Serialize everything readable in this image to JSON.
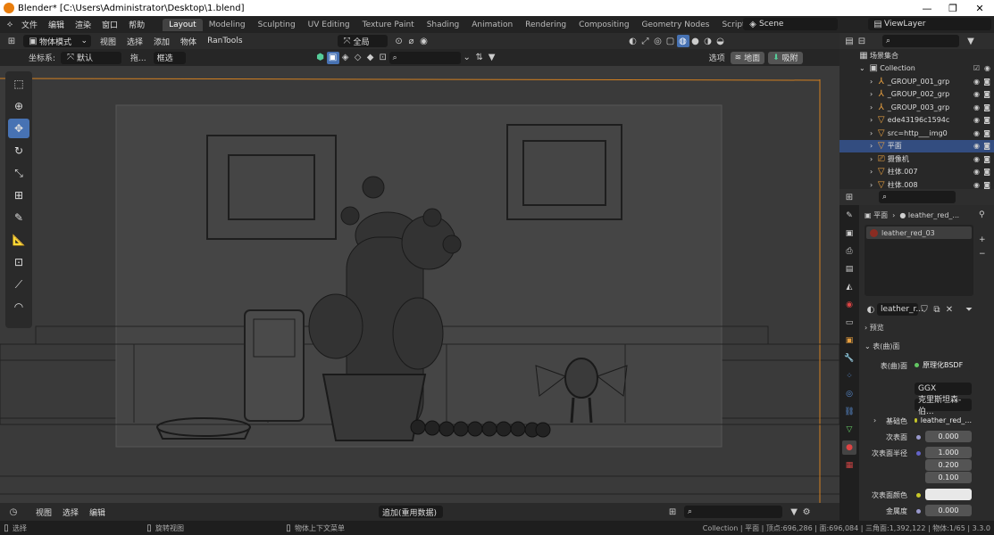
{
  "window": {
    "title": "Blender* [C:\\Users\\Administrator\\Desktop\\1.blend]",
    "minimize": "—",
    "maximize": "❐",
    "close": "✕"
  },
  "menubar": [
    "文件",
    "编辑",
    "渲染",
    "窗口",
    "帮助"
  ],
  "workspaces": [
    "Layout",
    "Modeling",
    "Sculpting",
    "UV Editing",
    "Texture Paint",
    "Shading",
    "Animation",
    "Rendering",
    "Compositing",
    "Geometry Nodes",
    "Scripting"
  ],
  "workspace_add": "+",
  "scene": "Scene",
  "view_layer": "ViewLayer",
  "viewport_header": {
    "mode": "物体模式",
    "menus": [
      "视图",
      "选择",
      "添加",
      "物体",
      "RanTools"
    ],
    "pivot": "全局",
    "options": "选项"
  },
  "viewport_header2": {
    "coord_label": "坐标系:",
    "coord_value": "默认",
    "drag_label": "拖...",
    "drag_value": "框选",
    "ground_btn": "地面",
    "snap_btn": "吸附"
  },
  "tools": [
    "select-box",
    "cursor",
    "move",
    "rotate",
    "scale",
    "transform",
    "annotate",
    "measure",
    "add-cube",
    "shear",
    "spin"
  ],
  "timeline": {
    "menus": [
      "视图",
      "选择",
      "编辑"
    ],
    "playback": "追加(重用数据)"
  },
  "statusbar": {
    "select": "选择",
    "rotate": "旋转视图",
    "context": "物体上下文菜单",
    "info": "Collection | 平面 | 顶点:696,286 | 面:696,084 | 三角面:1,392,122 | 物体:1/65 | 3.3.0"
  },
  "outliner": {
    "root": "场景集合",
    "collection": "Collection",
    "items": [
      {
        "name": "_GROUP_001_grp",
        "icon": "empty-icon",
        "selected": false
      },
      {
        "name": "_GROUP_002_grp",
        "icon": "empty-icon",
        "selected": false
      },
      {
        "name": "_GROUP_003_grp",
        "icon": "empty-icon",
        "selected": false
      },
      {
        "name": "ede43196c1594c",
        "icon": "mesh-icon",
        "selected": false
      },
      {
        "name": "src=http___img0",
        "icon": "mesh-icon",
        "selected": false
      },
      {
        "name": "平面",
        "icon": "mesh-icon",
        "selected": true
      },
      {
        "name": "摄像机",
        "icon": "camera-icon",
        "selected": false
      },
      {
        "name": "柱体.007",
        "icon": "mesh-icon",
        "selected": false
      },
      {
        "name": "柱体.008",
        "icon": "mesh-icon",
        "selected": false
      }
    ]
  },
  "properties": {
    "breadcrumb_object": "平面",
    "breadcrumb_material": "leather_red_...",
    "material_slot": "leather_red_03",
    "material_name": "leather_r...",
    "preview_label": "预览",
    "surface_label": "表(曲)面",
    "surface_field_label": "表(曲)面",
    "surface_value": "原理化BSDF",
    "distribution": "GGX",
    "subsurface_method": "克里斯坦森-伯...",
    "base_color_label": "基础色",
    "base_color_value": "leather_red_...",
    "subsurface_label": "次表面",
    "subsurface_value": "0.000",
    "subsurface_radius_label": "次表面半径",
    "subsurface_radius": [
      "1.000",
      "0.200",
      "0.100"
    ],
    "subsurface_color_label": "次表面颜色",
    "metallic_label": "金属度",
    "metallic_value": "0.000"
  },
  "colors": {
    "accent": "#4772b3",
    "selected_row": "#334d80",
    "yellow_socket": "#c7c729",
    "green_socket": "#63c763"
  }
}
